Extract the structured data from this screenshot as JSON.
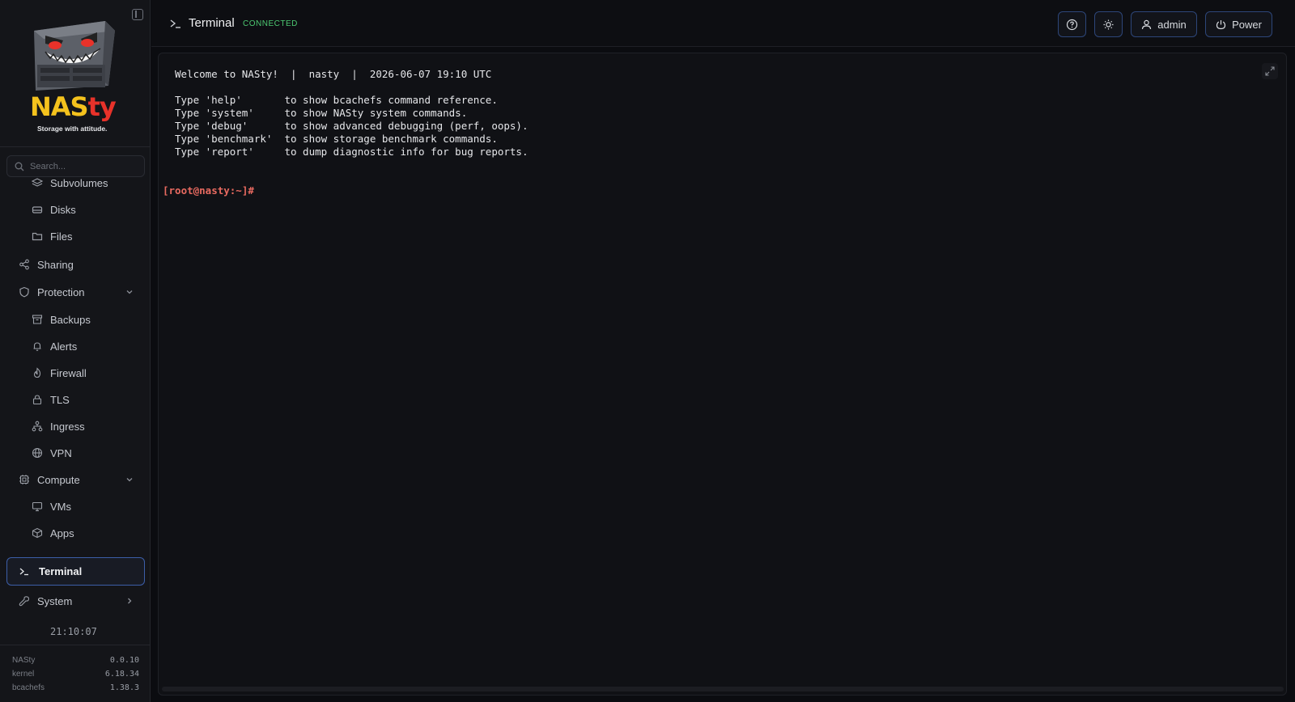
{
  "brand": {
    "name_part1": "NAS",
    "name_part2": "ty",
    "tagline": "Storage with attitude."
  },
  "search": {
    "placeholder": "Search..."
  },
  "nav": {
    "subvolumes": "Subvolumes",
    "disks": "Disks",
    "files": "Files",
    "sharing": "Sharing",
    "protection": "Protection",
    "backups": "Backups",
    "alerts": "Alerts",
    "firewall": "Firewall",
    "tls": "TLS",
    "ingress": "Ingress",
    "vpn": "VPN",
    "compute": "Compute",
    "vms": "VMs",
    "apps": "Apps",
    "terminal": "Terminal",
    "system": "System"
  },
  "clock": "21:10:07",
  "versions": [
    {
      "name": "NASty",
      "value": "0.0.10"
    },
    {
      "name": "kernel",
      "value": "6.18.34"
    },
    {
      "name": "bcachefs",
      "value": "1.38.3"
    }
  ],
  "header": {
    "title": "Terminal",
    "status": "CONNECTED",
    "user_label": "admin",
    "power_label": "Power"
  },
  "terminal": {
    "welcome": "Welcome to NASty!  |  nasty  |  2026-06-07 19:10 UTC",
    "lines": [
      "Type 'help'       to show bcachefs command reference.",
      "Type 'system'     to show NASty system commands.",
      "Type 'debug'      to show advanced debugging (perf, oops).",
      "Type 'benchmark'  to show storage benchmark commands.",
      "Type 'report'     to dump diagnostic info for bug reports."
    ],
    "prompt": "[root@nasty:~]#"
  },
  "colors": {
    "accent_border": "#3c5ea8",
    "status_green": "#4cc971",
    "prompt_red": "#e86a60",
    "logo_yellow": "#f4c21d",
    "logo_red": "#e8322a"
  }
}
